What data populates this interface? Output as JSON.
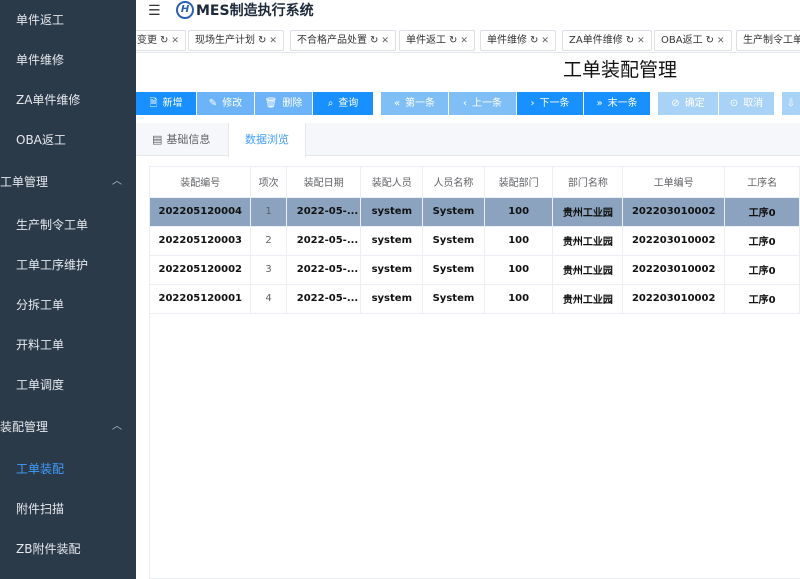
{
  "app": {
    "title": "MES制造执行系统",
    "logo_letter": "H"
  },
  "sidebar": {
    "items": [
      {
        "label": "单件返工",
        "type": "item"
      },
      {
        "label": "单件维修",
        "type": "item"
      },
      {
        "label": "ZA单件维修",
        "type": "item"
      },
      {
        "label": "OBA返工",
        "type": "item"
      },
      {
        "label": "工单管理",
        "type": "group"
      },
      {
        "label": "生产制令工单",
        "type": "item"
      },
      {
        "label": "工单工序维护",
        "type": "item"
      },
      {
        "label": "分拆工单",
        "type": "item"
      },
      {
        "label": "开料工单",
        "type": "item"
      },
      {
        "label": "工单调度",
        "type": "item"
      },
      {
        "label": "装配管理",
        "type": "group"
      },
      {
        "label": "工单装配",
        "type": "item",
        "active": true
      },
      {
        "label": "附件扫描",
        "type": "item"
      },
      {
        "label": "ZB附件装配",
        "type": "item"
      }
    ]
  },
  "tags": [
    "变更",
    "现场生产计划",
    "不合格产品处置",
    "单件返工",
    "单件维修",
    "ZA单件维修",
    "OBA返工",
    "生产制令工单"
  ],
  "page": {
    "title": "工单装配管理"
  },
  "toolbar": {
    "add": "新增",
    "edit": "修改",
    "delete": "删除",
    "query": "查询",
    "first": "第一条",
    "prev": "上一条",
    "next": "下一条",
    "last": "末一条",
    "confirm": "确定",
    "cancel": "取消"
  },
  "subtabs": {
    "basic": "基础信息",
    "browse": "数据浏览"
  },
  "table": {
    "columns": [
      "装配编号",
      "项次",
      "装配日期",
      "装配人员",
      "人员名称",
      "装配部门",
      "部门名称",
      "工单编号",
      "工序名"
    ],
    "rows": [
      [
        "202205120004",
        "1",
        "2022-05-...",
        "system",
        "System",
        "100",
        "贵州工业园",
        "202203010002",
        "工序0"
      ],
      [
        "202205120003",
        "2",
        "2022-05-...",
        "system",
        "System",
        "100",
        "贵州工业园",
        "202203010002",
        "工序0"
      ],
      [
        "202205120002",
        "3",
        "2022-05-...",
        "system",
        "System",
        "100",
        "贵州工业园",
        "202203010002",
        "工序0"
      ],
      [
        "202205120001",
        "4",
        "2022-05-...",
        "system",
        "System",
        "100",
        "贵州工业园",
        "202203010002",
        "工序0"
      ]
    ]
  }
}
